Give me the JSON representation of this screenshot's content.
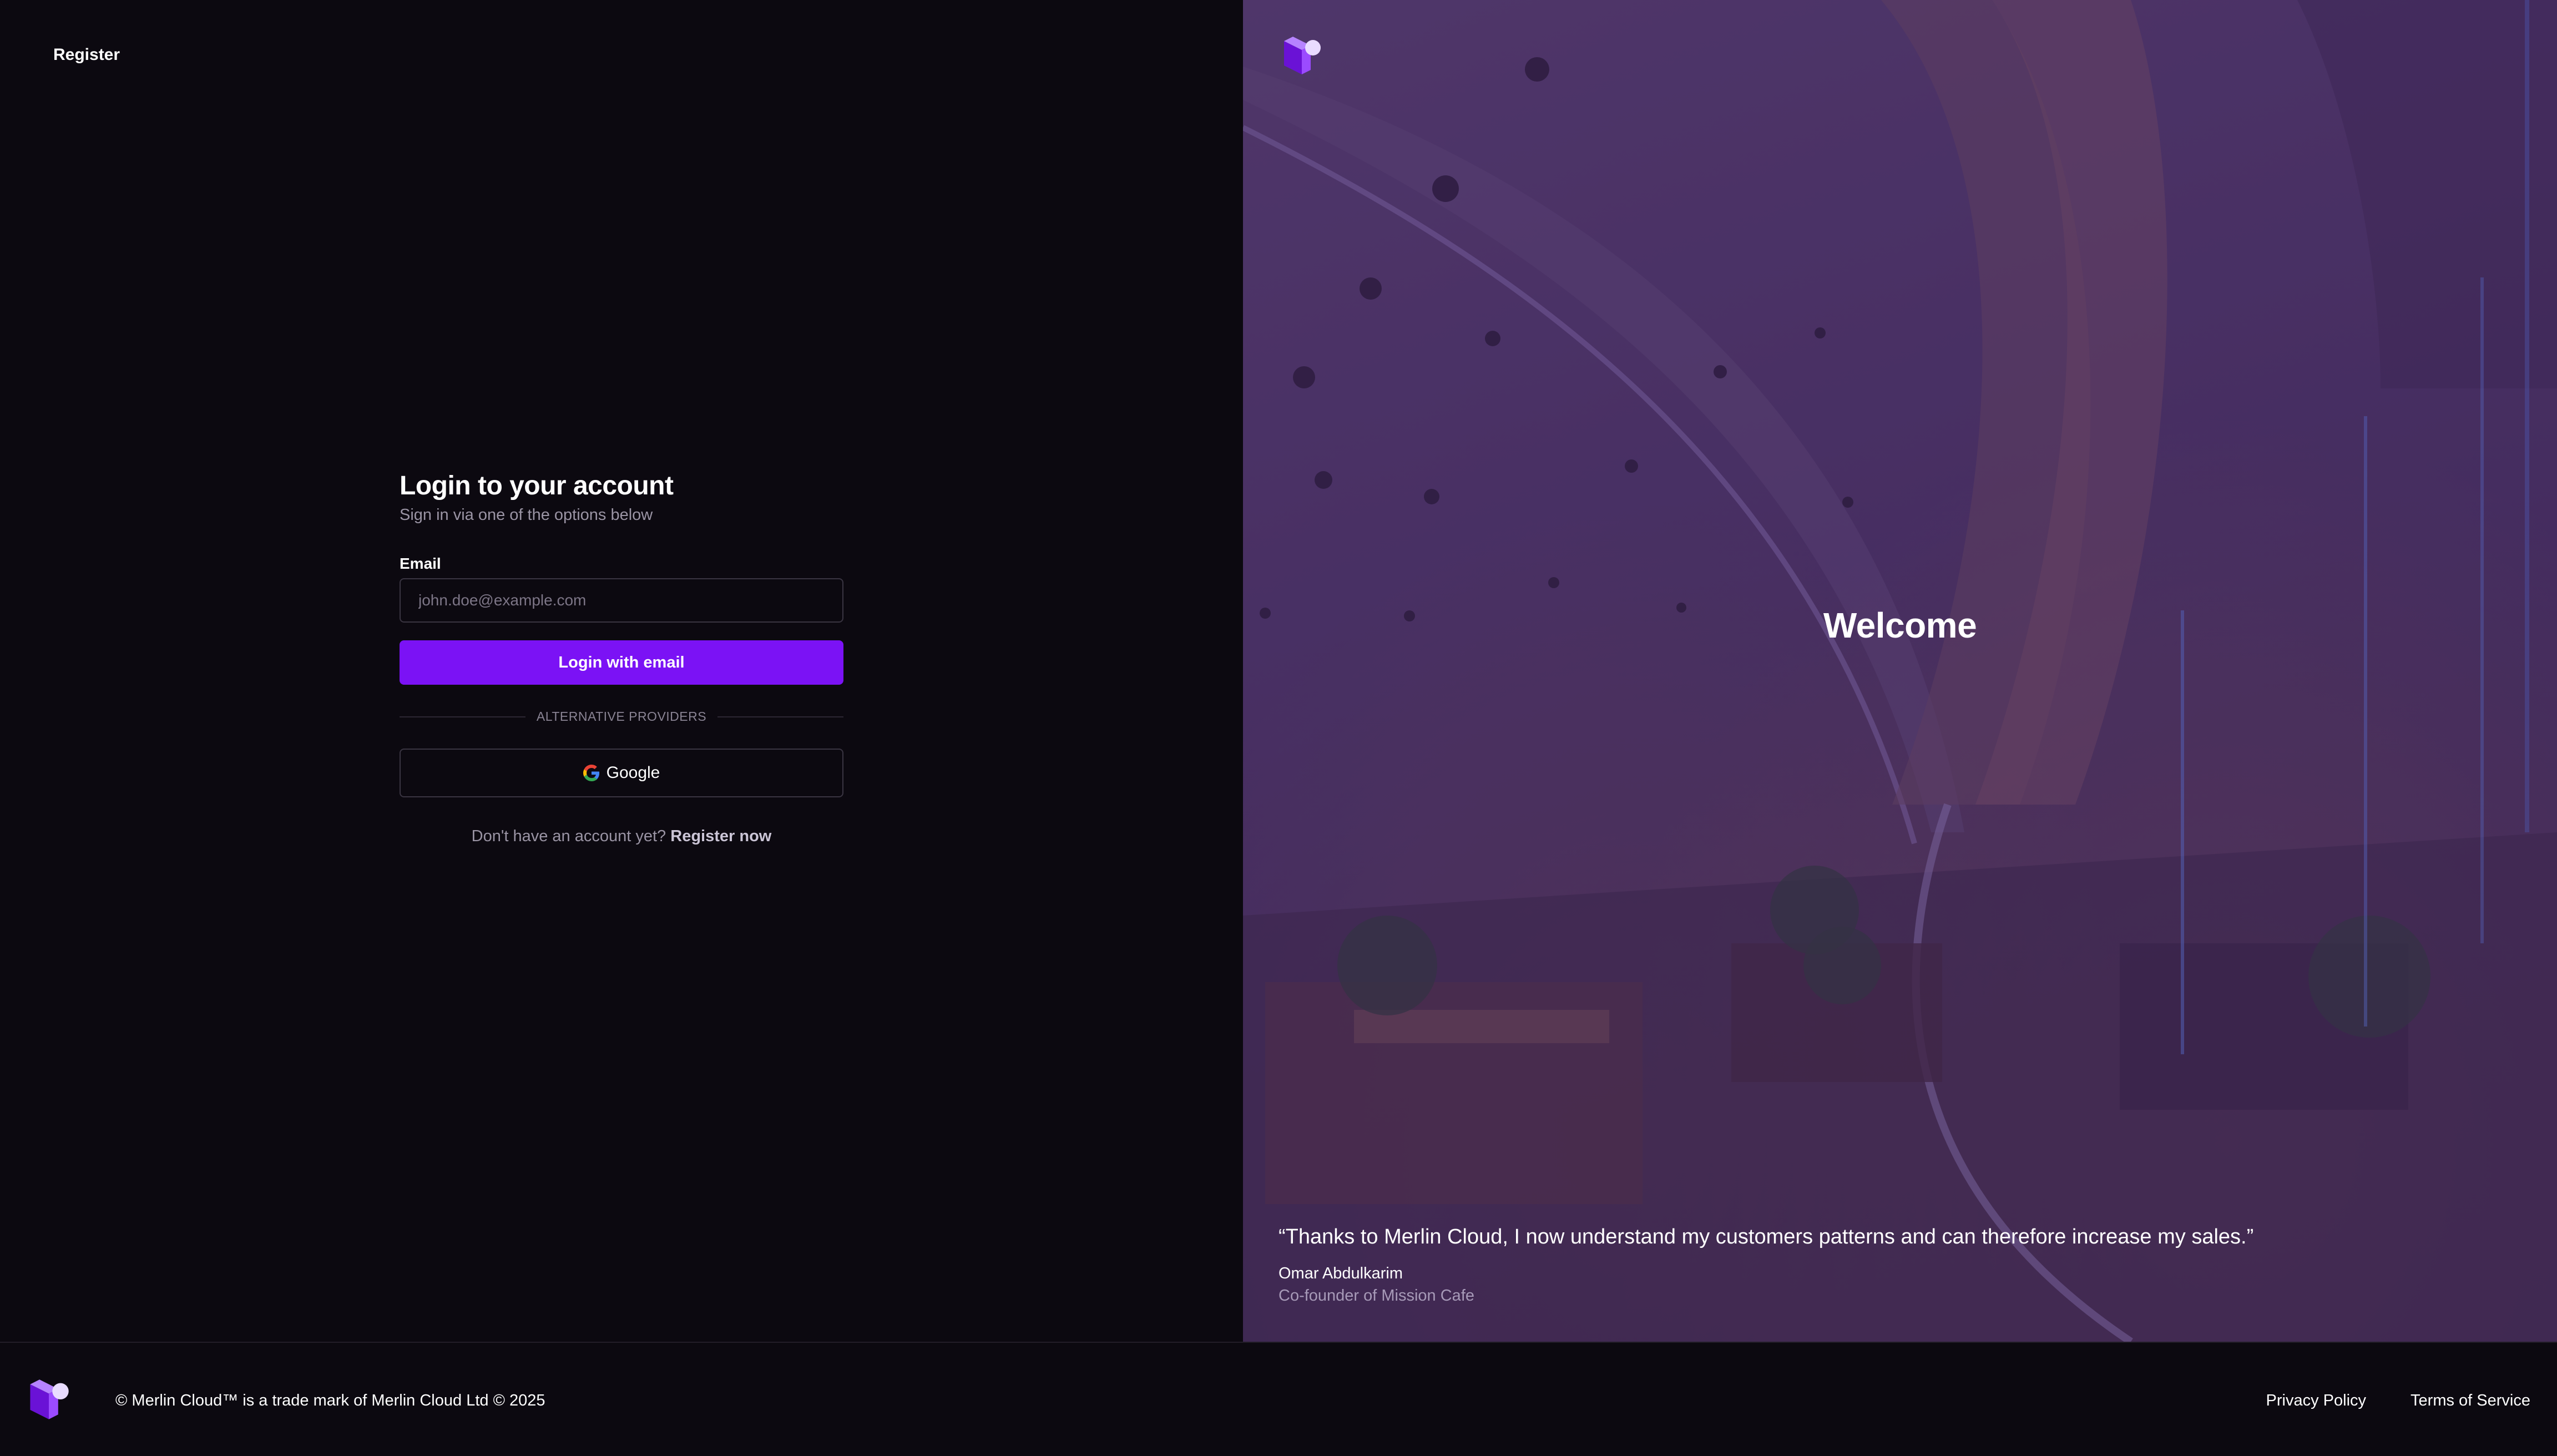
{
  "header": {
    "register_link": "Register"
  },
  "login": {
    "title": "Login to your account",
    "subtitle": "Sign in via one of the options below",
    "email_label": "Email",
    "email_placeholder": "john.doe@example.com",
    "email_value": "",
    "login_button": "Login with email",
    "divider_text": "ALTERNATIVE PROVIDERS",
    "google_button": "Google",
    "no_account_text": "Don't have an account yet?",
    "register_now": "Register now"
  },
  "hero": {
    "welcome": "Welcome",
    "quote": "“Thanks to Merlin Cloud, I now understand my customers patterns and can therefore increase my sales.”",
    "author_name": "Omar Abdulkarim",
    "author_role": "Co-founder of Mission Cafe"
  },
  "footer": {
    "copyright": "© Merlin Cloud™ is a trade mark of Merlin Cloud Ltd © 2025",
    "privacy": "Privacy Policy",
    "terms": "Terms of Service"
  },
  "colors": {
    "background": "#0c0910",
    "accent": "#7b12f5",
    "hero_tint": "#4b3664"
  },
  "icons": {
    "logo": "merlin-cloud-logo",
    "google": "google-g-icon"
  }
}
